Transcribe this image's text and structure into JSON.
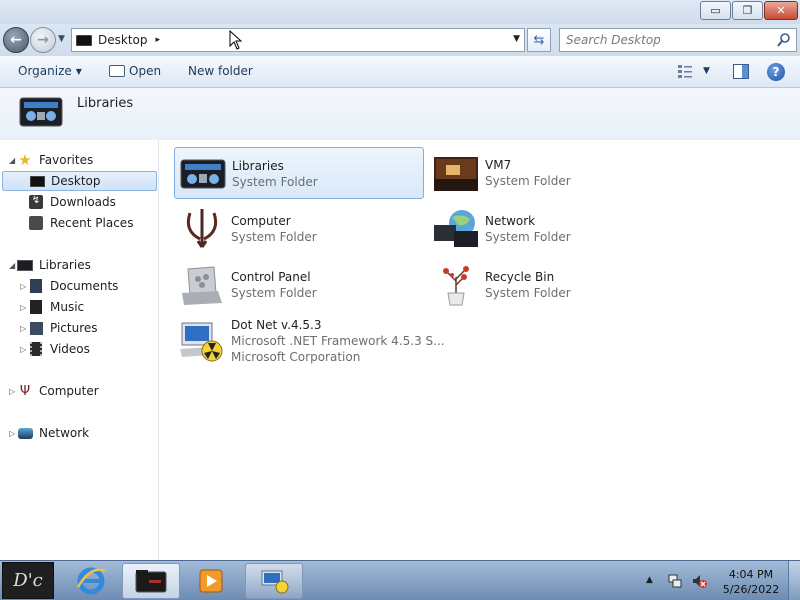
{
  "window": {
    "controls": {
      "minimize": "▭",
      "maximize": "❐",
      "close": "✕"
    }
  },
  "address_bar": {
    "location": "Desktop",
    "separator": "▸"
  },
  "search": {
    "placeholder": "Search Desktop"
  },
  "toolbar": {
    "organize_label": "Organize",
    "open_label": "Open",
    "new_folder_label": "New folder"
  },
  "header": {
    "title": "Libraries"
  },
  "nav_pane": {
    "favorites": {
      "label": "Favorites",
      "items": [
        {
          "label": "Desktop"
        },
        {
          "label": "Downloads"
        },
        {
          "label": "Recent Places"
        }
      ]
    },
    "libraries": {
      "label": "Libraries",
      "items": [
        {
          "label": "Documents"
        },
        {
          "label": "Music"
        },
        {
          "label": "Pictures"
        },
        {
          "label": "Videos"
        }
      ]
    },
    "computer": {
      "label": "Computer"
    },
    "network": {
      "label": "Network"
    }
  },
  "content": {
    "items": [
      {
        "name": "Libraries",
        "type": "System Folder",
        "icon": "libraries-icon"
      },
      {
        "name": "VM7",
        "type": "System Folder",
        "icon": "user-folder-icon"
      },
      {
        "name": "Computer",
        "type": "System Folder",
        "icon": "computer-icon"
      },
      {
        "name": "Network",
        "type": "System Folder",
        "icon": "network-icon"
      },
      {
        "name": "Control Panel",
        "type": "System Folder",
        "icon": "control-panel-icon"
      },
      {
        "name": "Recycle Bin",
        "type": "System Folder",
        "icon": "recycle-bin-icon"
      },
      {
        "name": "Dot Net v.4.5.3",
        "type": "Microsoft .NET Framework 4.5.3 S...",
        "publisher": "Microsoft Corporation",
        "icon": "dotnet-installer-icon"
      }
    ]
  },
  "taskbar": {
    "start_label": "D'c",
    "clock": {
      "time": "4:04 PM",
      "date": "5/26/2022"
    }
  },
  "colors": {
    "selection_border": "#84acdd",
    "selection_fill": "#d8e8fa",
    "taskbar": "#6d8cb3",
    "secondary_text": "#6d6d6d"
  }
}
